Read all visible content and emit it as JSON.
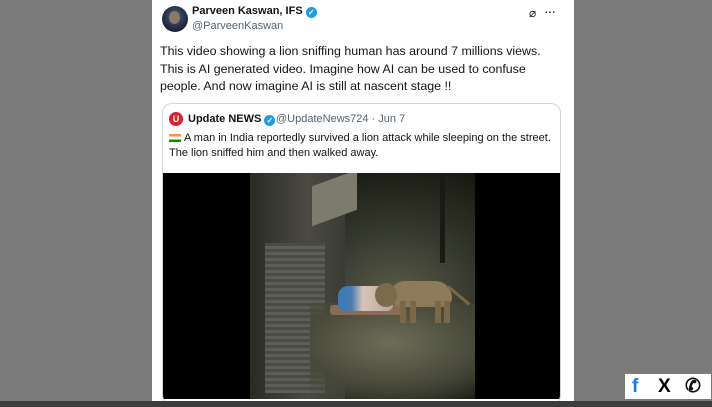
{
  "tweet": {
    "author_name": "Parveen Kaswan, IFS",
    "author_handle": "@ParveenKaswan",
    "text": "This video showing a lion sniffing human has around 7 millions views. This is AI generated video. Imagine how AI can be used to confuse people. And now imagine AI is still at nascent stage !!",
    "icons": {
      "grok": "grok-icon",
      "more": "more-icon",
      "verified": "verified-badge-icon"
    }
  },
  "quote": {
    "name": "Update NEWS",
    "handle_date": "@UpdateNews724 · Jun 7",
    "text": "A man in India reportedly survived a lion attack while sleeping on the street. The lion sniffed him and then walked away.",
    "logo_letter": "U",
    "media": "Night street scene: a lion sniffing a man sleeping on the street"
  },
  "share": {
    "facebook": "f",
    "x": "X",
    "whatsapp": "✆",
    "colors": {
      "facebook": "#1877f2",
      "x": "#000000",
      "whatsapp": "#111111"
    }
  }
}
